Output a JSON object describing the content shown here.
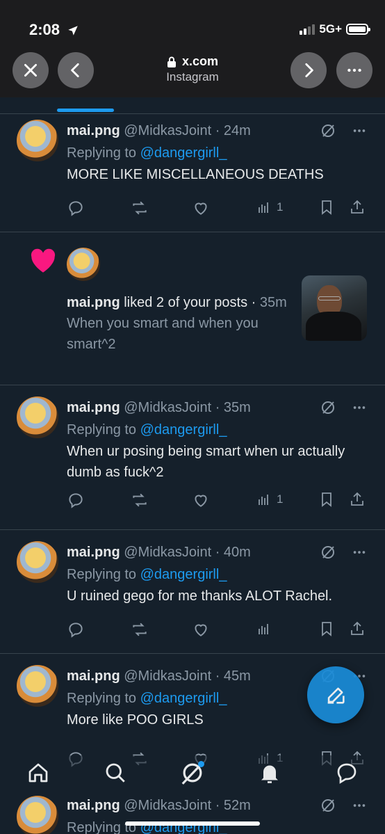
{
  "status": {
    "time": "2:08",
    "network": "5G+"
  },
  "browser": {
    "host": "x.com",
    "page_title": "Instagram"
  },
  "colors": {
    "accent": "#1d9bf0",
    "background": "#15202b",
    "heart": "#f91880"
  },
  "feed": {
    "reply1": {
      "display_name": "mai.png",
      "meta": "@MidkasJoint · 24m",
      "replying_prefix": "Replying to ",
      "replying_handle": "@dangergirll_",
      "text": "MORE LIKE MISCELLANEOUS DEATHS",
      "views": "1"
    },
    "like": {
      "display_name": "mai.png",
      "action": " liked 2 of your posts · ",
      "time": "35m",
      "preview": "When you smart and when you smart^2"
    },
    "reply2": {
      "display_name": "mai.png",
      "meta": "@MidkasJoint · 35m",
      "replying_prefix": "Replying to ",
      "replying_handle": "@dangergirll_",
      "text": "When ur posing being smart when ur actually dumb as fuck^2",
      "views": "1"
    },
    "reply3": {
      "display_name": "mai.png",
      "meta": "@MidkasJoint · 40m",
      "replying_prefix": "Replying to ",
      "replying_handle": "@dangergirll_",
      "text": "U ruined gego for me thanks ALOT Rachel."
    },
    "reply4": {
      "display_name": "mai.png",
      "meta": "@MidkasJoint · 45m",
      "replying_prefix": "Replying to ",
      "replying_handle": "@dangergirll_",
      "text": "More like POO GIRLS",
      "views": "1"
    },
    "reply5": {
      "display_name": "mai.png",
      "meta": "@MidkasJoint · 52m",
      "replying_prefix": "Replying to ",
      "replying_handle": "@dangergirll_"
    }
  },
  "nav": [
    "home-icon",
    "search-icon",
    "grok-icon",
    "notifications-icon",
    "messages-icon"
  ]
}
